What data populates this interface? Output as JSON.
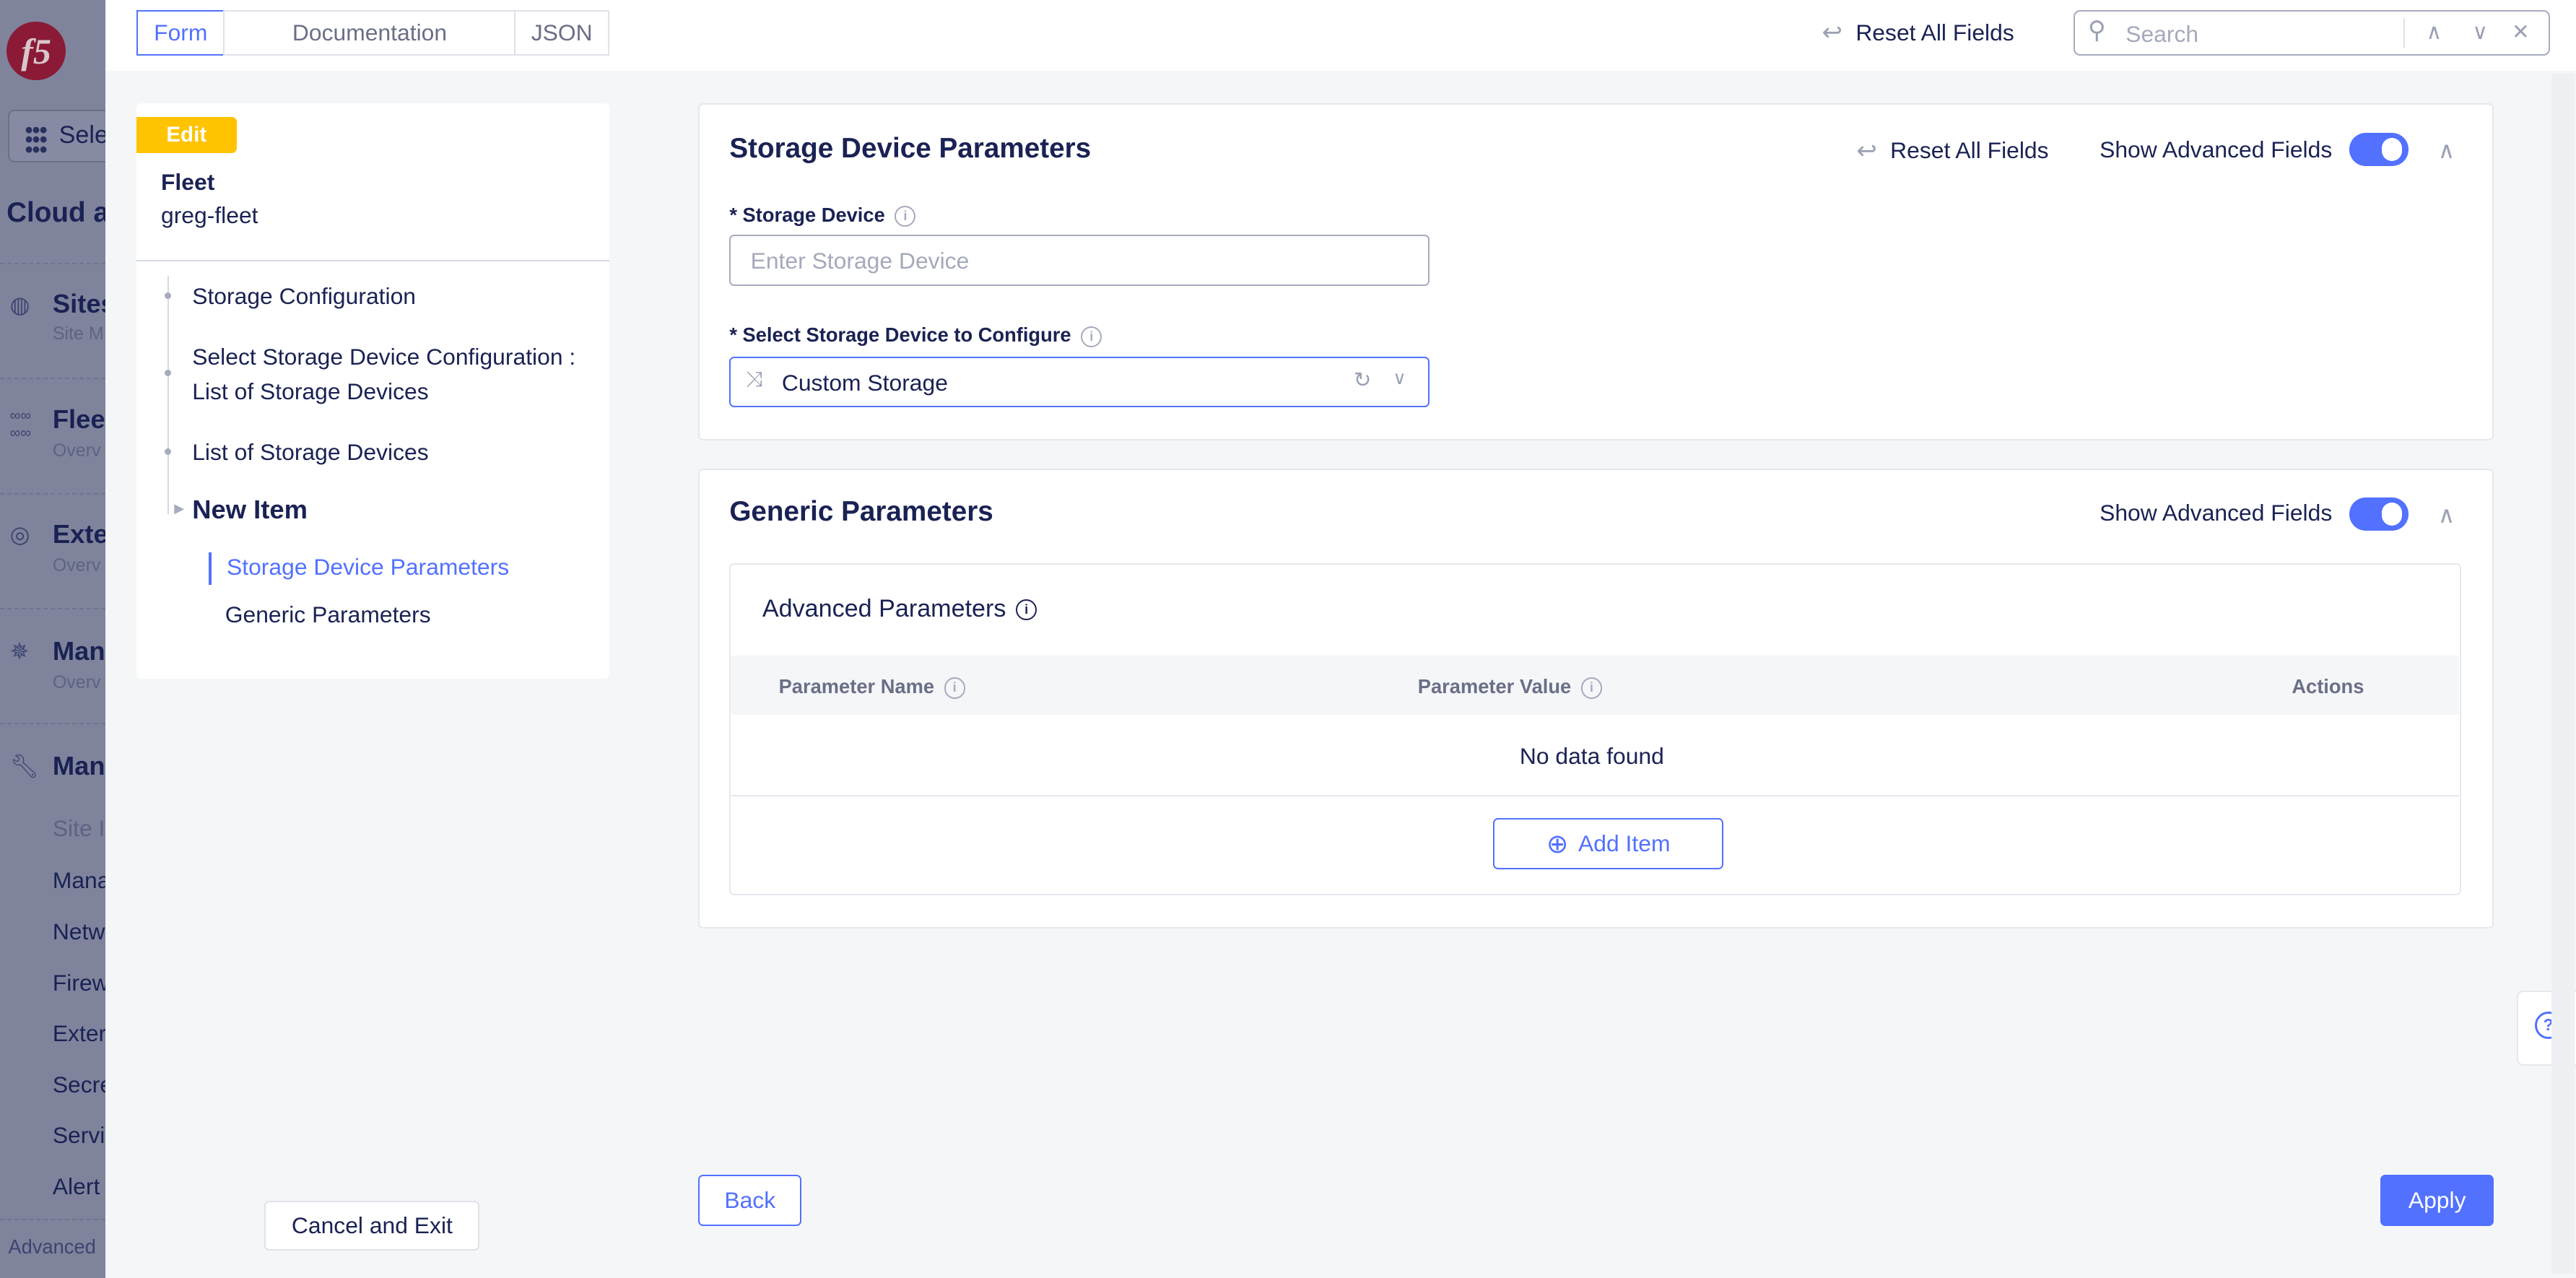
{
  "sidebar": {
    "logo": "f5",
    "select_label": "Sele",
    "title": "Cloud a",
    "sections": [
      {
        "label": "Sites",
        "sub": "Site M",
        "icon": "globe-icon"
      },
      {
        "label": "Flee",
        "sub": "Overv",
        "icon": "fleet-icon"
      },
      {
        "label": "Exte",
        "sub": "Overv",
        "icon": "external-icon"
      },
      {
        "label": "Man",
        "sub": "Overv",
        "icon": "helm-icon"
      },
      {
        "label": "Man",
        "icon": "wrench-icon"
      }
    ],
    "items": [
      "Site I",
      "Mana",
      "Netw",
      "Firew",
      "Exter",
      "Secre",
      "Servi",
      "Alert"
    ],
    "footer": "Advanced"
  },
  "topbar": {
    "tabs": [
      "Form",
      "Documentation",
      "JSON"
    ],
    "active_tab": "Form",
    "reset_label": "Reset All Fields",
    "search_placeholder": "Search"
  },
  "left_panel": {
    "badge": "Edit",
    "object_type": "Fleet",
    "object_name": "greg-fleet",
    "tree": [
      "Storage Configuration",
      "Select Storage Device Configuration : List of Storage Devices",
      "List of Storage Devices",
      "New Item"
    ],
    "subsections": [
      "Storage Device Parameters",
      "Generic Parameters"
    ],
    "active_subsection": "Storage Device Parameters",
    "cancel_label": "Cancel and Exit"
  },
  "storage_card": {
    "title": "Storage Device Parameters",
    "reset_label": "Reset All Fields",
    "advanced_label": "Show Advanced Fields",
    "advanced_on": true,
    "storage_device_label": "* Storage Device",
    "storage_device_placeholder": "Enter Storage Device",
    "select_label": "* Select Storage Device to Configure",
    "select_value": "Custom Storage"
  },
  "generic_card": {
    "title": "Generic Parameters",
    "advanced_label": "Show Advanced Fields",
    "advanced_on": true,
    "table_title": "Advanced Parameters",
    "columns": [
      "Parameter Name",
      "Parameter Value",
      "Actions"
    ],
    "empty_text": "No data found",
    "add_label": "Add Item"
  },
  "footer": {
    "back_label": "Back",
    "apply_label": "Apply"
  },
  "colors": {
    "accent": "#5271ff",
    "badge": "#ffc300",
    "text": "#1a2254"
  }
}
